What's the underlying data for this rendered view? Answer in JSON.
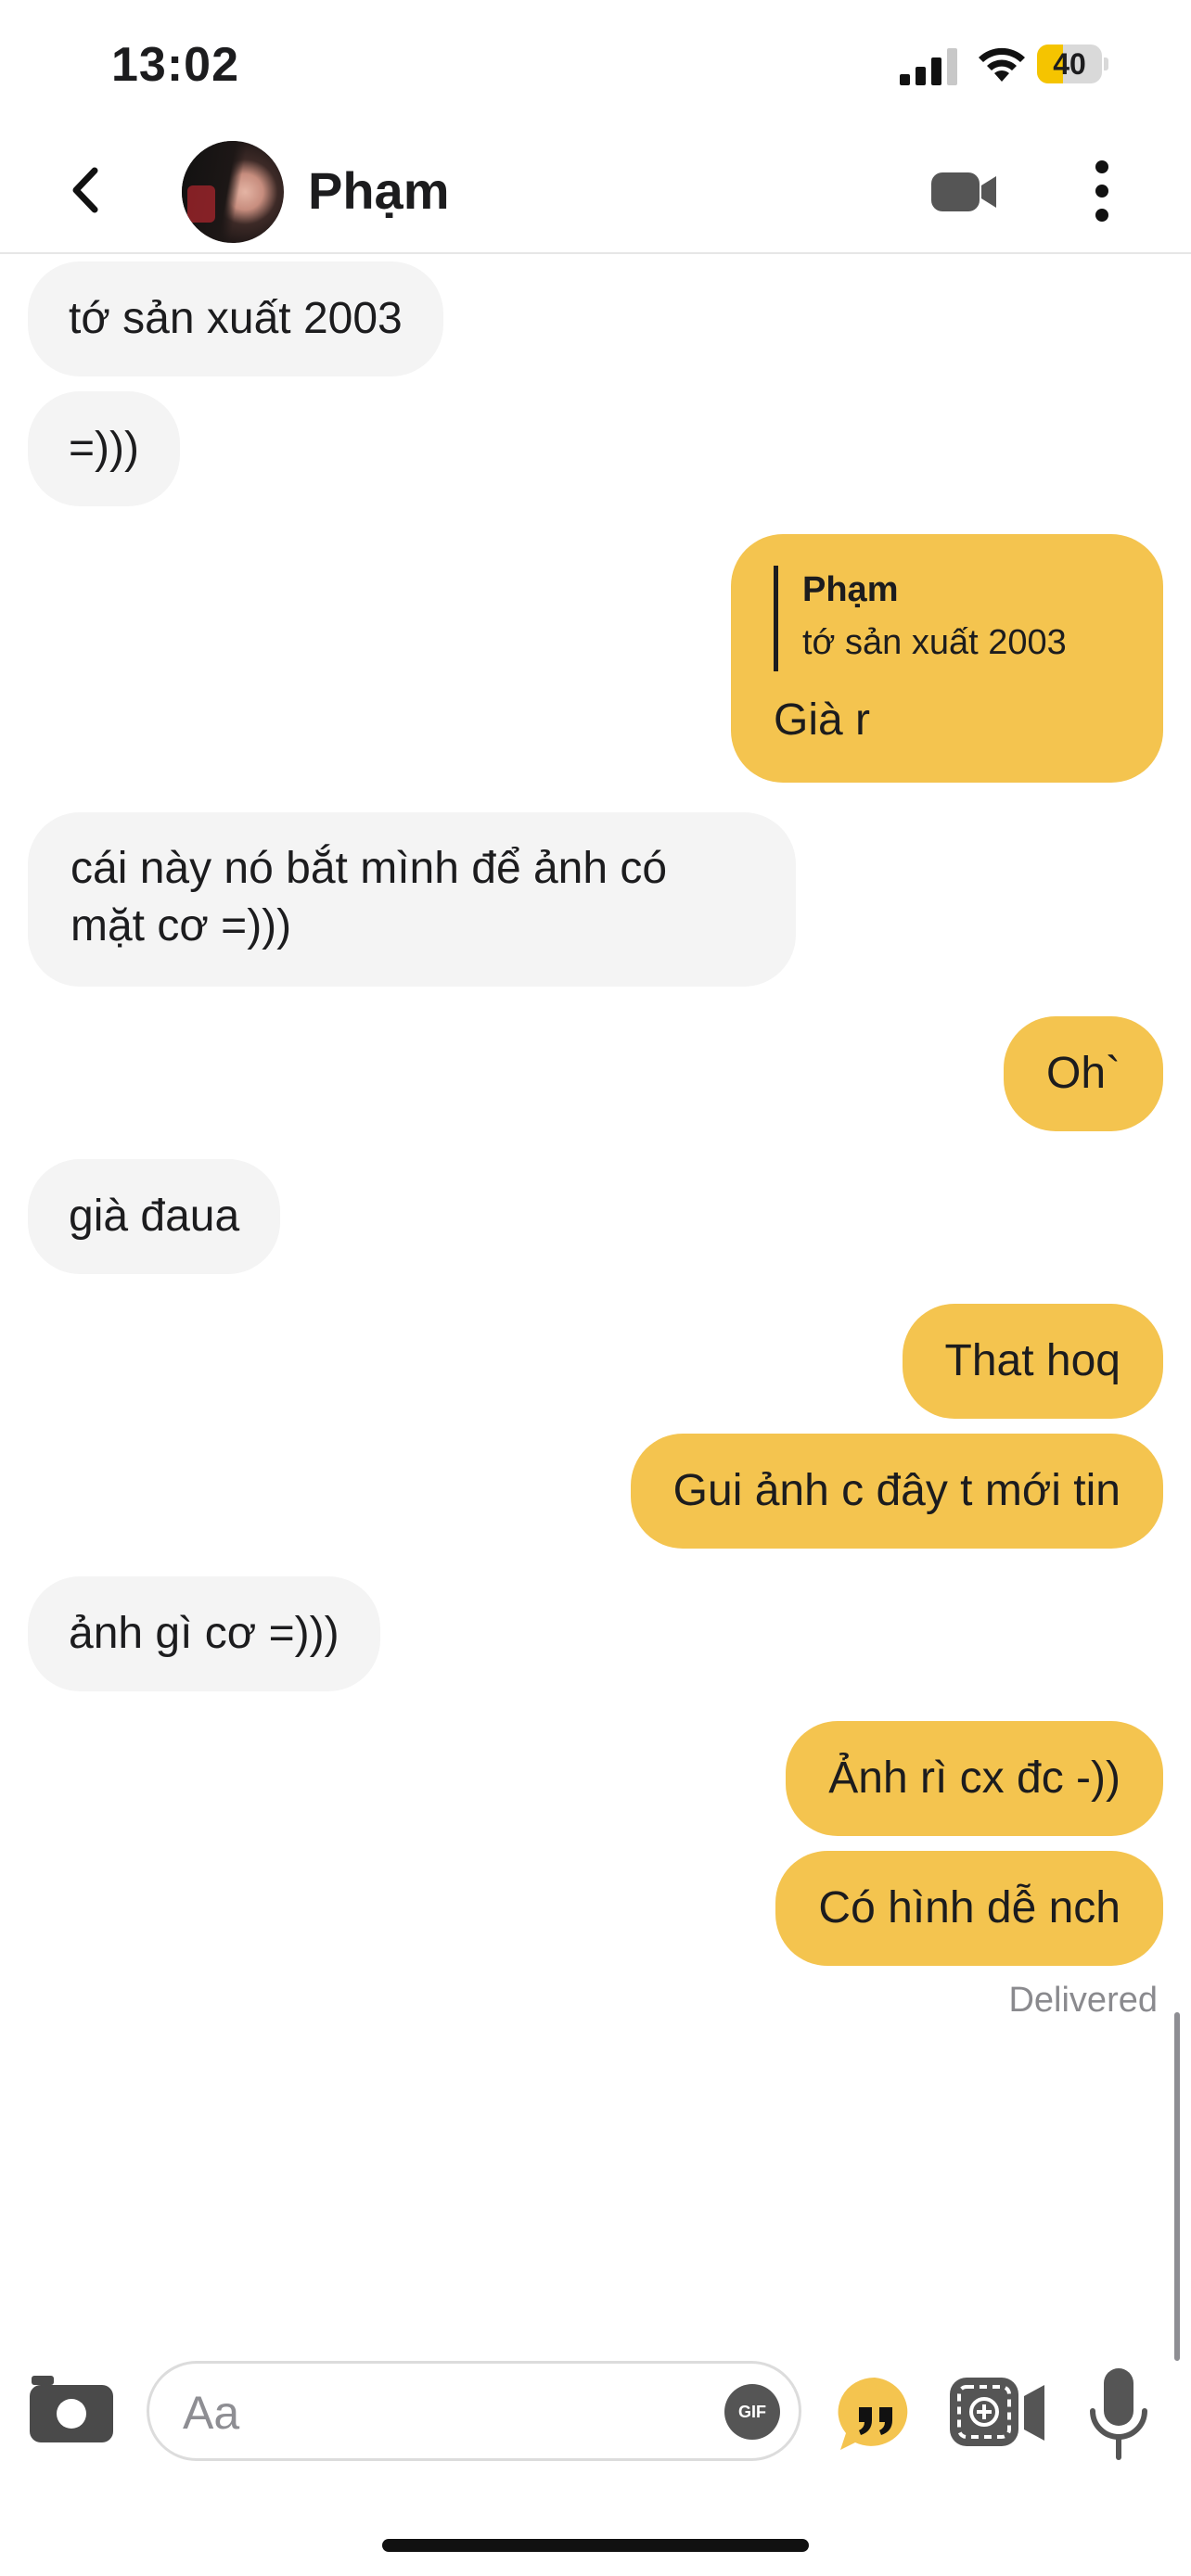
{
  "status_bar": {
    "time": "13:02",
    "battery_level": 40,
    "battery_label": "40"
  },
  "header": {
    "contact_name": "Phạm",
    "icons": {
      "back": "chevron-left-icon",
      "video": "video-camera-icon",
      "more": "vertical-ellipsis-icon"
    }
  },
  "messages": [
    {
      "direction": "incoming",
      "text": "tớ sản xuất 2003"
    },
    {
      "direction": "incoming",
      "text": "=)))"
    },
    {
      "direction": "outgoing",
      "quote_author": "Phạm",
      "quote_text": "tớ sản xuất 2003",
      "text": "Già r"
    },
    {
      "direction": "incoming",
      "text_line1": "cái này nó bắt mình để ảnh có",
      "text_line2": "mặt cơ =)))"
    },
    {
      "direction": "outgoing",
      "text": "Oh`"
    },
    {
      "direction": "incoming",
      "text": "già đaua"
    },
    {
      "direction": "outgoing",
      "text": "That hoq"
    },
    {
      "direction": "outgoing",
      "text": "Gui ảnh c đây t mới tin"
    },
    {
      "direction": "incoming",
      "text": "ảnh gì cơ =)))"
    },
    {
      "direction": "outgoing",
      "text": "Ảnh rì cx đc -))"
    },
    {
      "direction": "outgoing",
      "text": "Có hình dễ nch"
    }
  ],
  "delivery_status": "Delivered",
  "composer": {
    "placeholder": "Aa",
    "gif_label": "GIF",
    "icons": {
      "camera": "camera-icon",
      "gif": "gif-icon",
      "quote": "quote-bubble-icon",
      "effect": "photo-effect-icon",
      "mic": "microphone-icon"
    }
  },
  "colors": {
    "outgoing_bubble": "#f4c44f",
    "incoming_bubble": "#f4f4f4",
    "accent": "#f5c400"
  }
}
